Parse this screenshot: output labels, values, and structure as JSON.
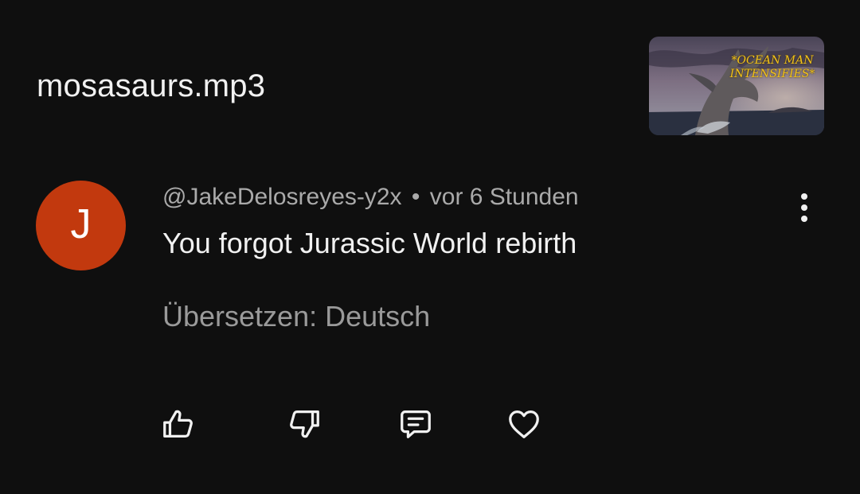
{
  "video": {
    "title": "mosasaurs.mp3",
    "thumbnail_caption": "*OCEAN MAN INTENSIFIES*"
  },
  "comment": {
    "avatar_letter": "J",
    "avatar_color": "#c2390e",
    "author": "@JakeDelosreyes-y2x",
    "separator": "•",
    "time": "vor 6 Stunden",
    "text": "You forgot Jurassic World rebirth",
    "translate_label": "Übersetzen: Deutsch"
  },
  "actions": {
    "icons": [
      "thumbs-up-icon",
      "thumbs-down-icon",
      "reply-icon",
      "heart-icon"
    ],
    "more_icon": "more-vertical-icon"
  },
  "colors": {
    "background": "#0f0f0f",
    "primary_text": "#f1f1f1",
    "secondary_text": "#aaaaaa",
    "caption_yellow": "#f2c21a"
  }
}
